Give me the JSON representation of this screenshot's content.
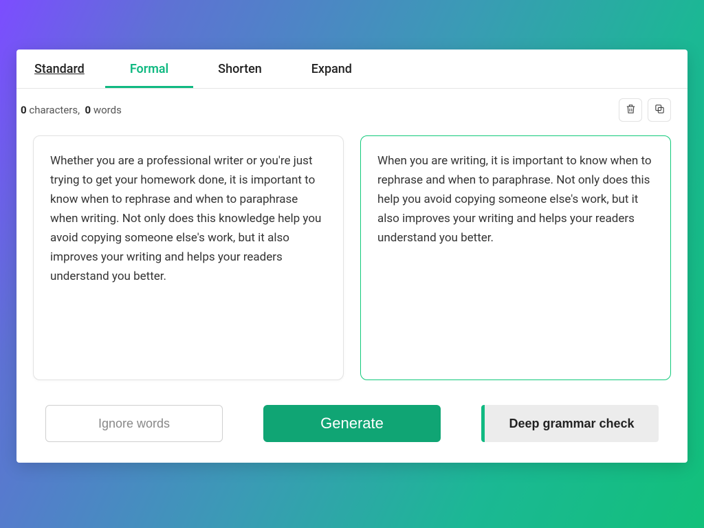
{
  "tabs": {
    "standard": "Standard",
    "formal": "Formal",
    "shorten": "Shorten",
    "expand": "Expand",
    "active": "formal"
  },
  "counts": {
    "chars_value": "0",
    "chars_label": "characters,",
    "words_value": "0",
    "words_label": "words"
  },
  "panes": {
    "input_text": "Whether you are a professional writer or you're just trying to get your homework done, it is important to know when to rephrase and when to paraphrase when writing. Not only does this knowledge help you avoid copying someone else's work, but it also improves your writing and helps your readers understand you better.",
    "output_text": "When you are writing, it is important to know when to rephrase and when to paraphrase. Not only does this help you avoid copying someone else's work, but it also improves your writing and helps your readers understand you better."
  },
  "buttons": {
    "ignore": "Ignore words",
    "generate": "Generate",
    "grammar": "Deep grammar check"
  },
  "icons": {
    "trash": "trash-icon",
    "copy": "copy-icon"
  }
}
